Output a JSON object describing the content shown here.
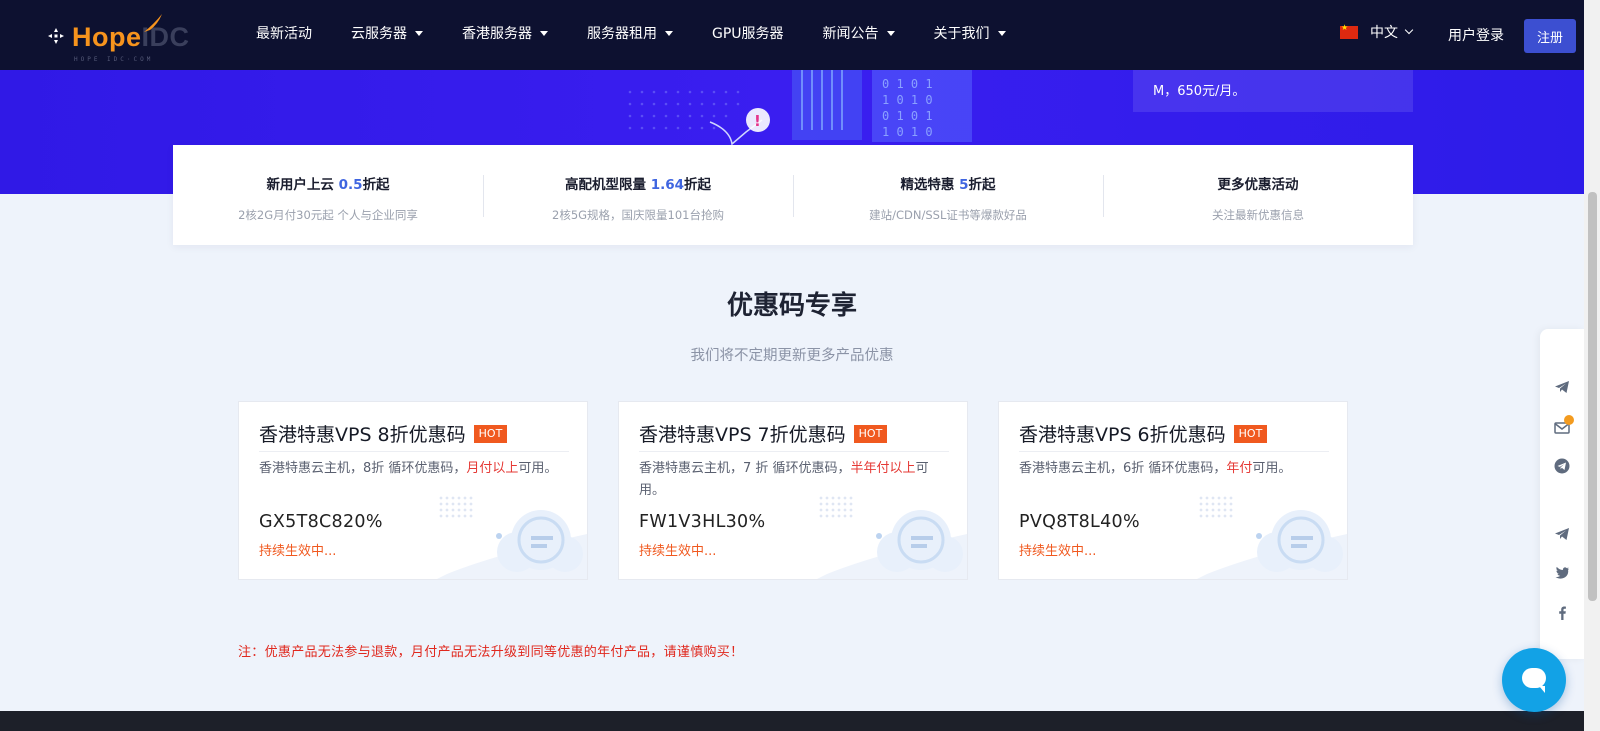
{
  "header": {
    "logo_text_a": "Hope",
    "logo_text_b": "IDC",
    "logo_sub": "HOPE IDC·COM",
    "nav": [
      {
        "label": "最新活动",
        "dropdown": false
      },
      {
        "label": "云服务器",
        "dropdown": true
      },
      {
        "label": "香港服务器",
        "dropdown": true
      },
      {
        "label": "服务器租用",
        "dropdown": true
      },
      {
        "label": "GPU服务器",
        "dropdown": false
      },
      {
        "label": "新闻公告",
        "dropdown": true
      },
      {
        "label": "关于我们",
        "dropdown": true
      }
    ],
    "language": "中文",
    "login": "用户登录",
    "register": "注册"
  },
  "hero": {
    "card_text": "M，650元/月。"
  },
  "promo": [
    {
      "title_pre": "新用户上云 ",
      "title_hl": "0.5",
      "title_post": "折起",
      "sub": "2核2G月付30元起 个人与企业同享"
    },
    {
      "title_pre": "高配机型限量 ",
      "title_hl": "1.64",
      "title_post": "折起",
      "sub": "2核5G规格，国庆限量101台抢购"
    },
    {
      "title_pre": "精选特惠 ",
      "title_hl": "5",
      "title_post": "折起",
      "sub": "建站/CDN/SSL证书等爆款好品"
    },
    {
      "title_pre": "更多优惠活动",
      "title_hl": "",
      "title_post": "",
      "sub": "关注最新优惠信息"
    }
  ],
  "section": {
    "title": "优惠码专享",
    "subtitle": "我们将不定期更新更多产品优惠"
  },
  "coupons": [
    {
      "title": "香港特惠VPS 8折优惠码",
      "hot": "HOT",
      "desc_pre": "香港特惠云主机，8折 循环优惠码，",
      "desc_red": "月付以上",
      "desc_post": "可用。",
      "code": "GX5T8C820%",
      "status": "持续生效中..."
    },
    {
      "title": "香港特惠VPS 7折优惠码",
      "hot": "HOT",
      "desc_pre": "香港特惠云主机，7 折 循环优惠码，",
      "desc_red": "半年付以上",
      "desc_post": "可用。",
      "code": "FW1V3HL30%",
      "status": "持续生效中..."
    },
    {
      "title": "香港特惠VPS 6折优惠码",
      "hot": "HOT",
      "desc_pre": "香港特惠云主机，6折 循环优惠码，",
      "desc_red": "年付",
      "desc_post": "可用。",
      "code": "PVQ8T8L40%",
      "status": "持续生效中..."
    }
  ],
  "note": "注：优惠产品无法参与退款，月付产品无法升级到同等优惠的年付产品，请谨慎购买！",
  "rail_icons": [
    "telegram-icon",
    "email-icon",
    "telegram-circle-icon",
    "telegram-icon",
    "twitter-icon",
    "facebook-icon"
  ],
  "colors": {
    "header_bg": "#0d1130",
    "hero_bg": "#3019e6",
    "accent_blue": "#3f65e0",
    "register_bg": "#3c4fd1",
    "hot_orange": "#f0591f",
    "warning_red": "#e0281e",
    "chat_blue": "#12a2e6"
  }
}
